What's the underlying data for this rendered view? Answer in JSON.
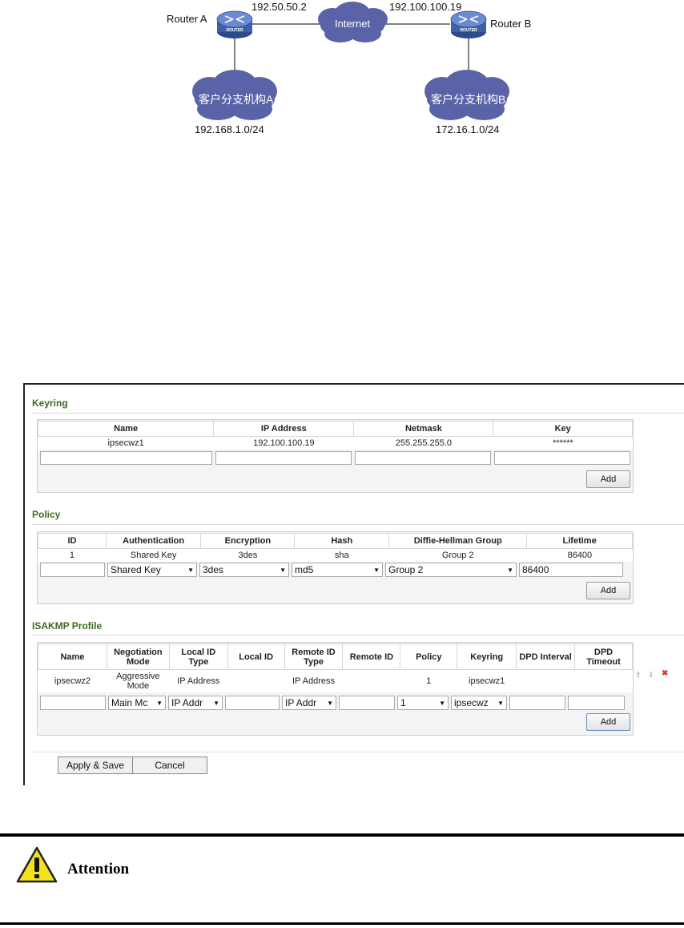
{
  "diagram": {
    "router_a_label": "Router A",
    "router_b_label": "Router B",
    "router_badge": "ROUTER",
    "router_a_ip": "192.50.50.2",
    "router_b_ip": "192.100.100.19",
    "internet_label": "Internet",
    "branch_a_label": "客户分支机构A",
    "branch_b_label": "客户分支机构B",
    "branch_a_subnet": "192.168.1.0/24",
    "branch_b_subnet": "172.16.1.0/24",
    "cloud_color": "#5a63a8",
    "router_color": "#3f5fa8"
  },
  "keyring": {
    "title": "Keyring",
    "headers": [
      "Name",
      "IP Address",
      "Netmask",
      "Key"
    ],
    "row": [
      "ipsecwz1",
      "192.100.100.19",
      "255.255.255.0",
      "******"
    ],
    "add_label": "Add"
  },
  "policy": {
    "title": "Policy",
    "headers": [
      "ID",
      "Authentication",
      "Encryption",
      "Hash",
      "Diffie-Hellman Group",
      "Lifetime"
    ],
    "row": [
      "1",
      "Shared Key",
      "3des",
      "sha",
      "Group 2",
      "86400"
    ],
    "inputs": {
      "auth": "Shared Key",
      "enc": "3des",
      "hash": "md5",
      "dh": "Group 2",
      "lifetime": "86400"
    },
    "add_label": "Add"
  },
  "isakmp": {
    "title": "ISAKMP Profile",
    "headers": {
      "name": "Name",
      "neg1": "Negotiation",
      "neg2": "Mode",
      "lidt1": "Local ID",
      "lidt2": "Type",
      "lid": "Local ID",
      "ridt1": "Remote ID",
      "ridt2": "Type",
      "rid": "Remote ID",
      "policy": "Policy",
      "keyring": "Keyring",
      "dpdi": "DPD Interval",
      "dpdt1": "DPD",
      "dpdt2": "Timeout"
    },
    "row": {
      "name": "ipsecwz2",
      "neg1": "Aggressive",
      "neg2": "Mode",
      "lidt": "IP Address",
      "lid": "",
      "ridt": "IP Address",
      "rid": "",
      "policy": "1",
      "keyring": "ipsecwz1"
    },
    "inputs": {
      "neg": "Main Mc",
      "lidt": "IP Addr",
      "ridt": "IP Addr",
      "policy": "1",
      "keyring": "ipsecwz"
    },
    "add_label": "Add"
  },
  "footer": {
    "apply_label": "Apply & Save",
    "cancel_label": "Cancel"
  },
  "attention": {
    "label": "Attention"
  }
}
